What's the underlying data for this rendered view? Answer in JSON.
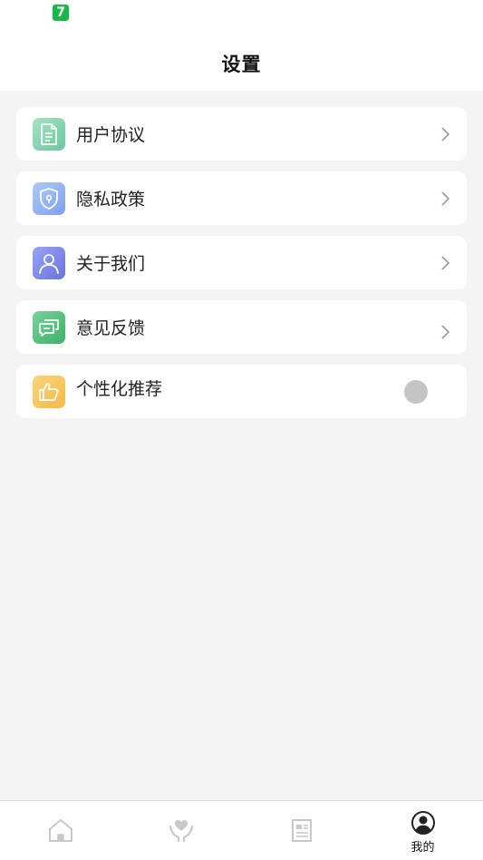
{
  "status_bar": {
    "app_badge": "7"
  },
  "header": {
    "title": "设置"
  },
  "settings": {
    "items": [
      {
        "label": "用户协议",
        "icon": "document-icon",
        "color": "#7fd0a8"
      },
      {
        "label": "隐私政策",
        "icon": "shield-icon",
        "color": "#8fb1f0"
      },
      {
        "label": "关于我们",
        "icon": "user-icon",
        "color": "#7b86e8"
      },
      {
        "label": "意见反馈",
        "icon": "chat-icon",
        "color": "#4fbf78"
      },
      {
        "label": "个性化推荐",
        "icon": "thumbs-up-icon",
        "color": "#f7c45a",
        "toggle": false
      }
    ]
  },
  "tabbar": {
    "tabs": [
      {
        "icon": "home-icon",
        "label": ""
      },
      {
        "icon": "heart-hand-icon",
        "label": ""
      },
      {
        "icon": "news-icon",
        "label": ""
      },
      {
        "icon": "profile-icon",
        "label": "我的",
        "active": true
      }
    ]
  },
  "colors": {
    "page_background": "#f4f4f4",
    "card_background": "#ffffff",
    "toggle_off": "#c4c4c4"
  }
}
